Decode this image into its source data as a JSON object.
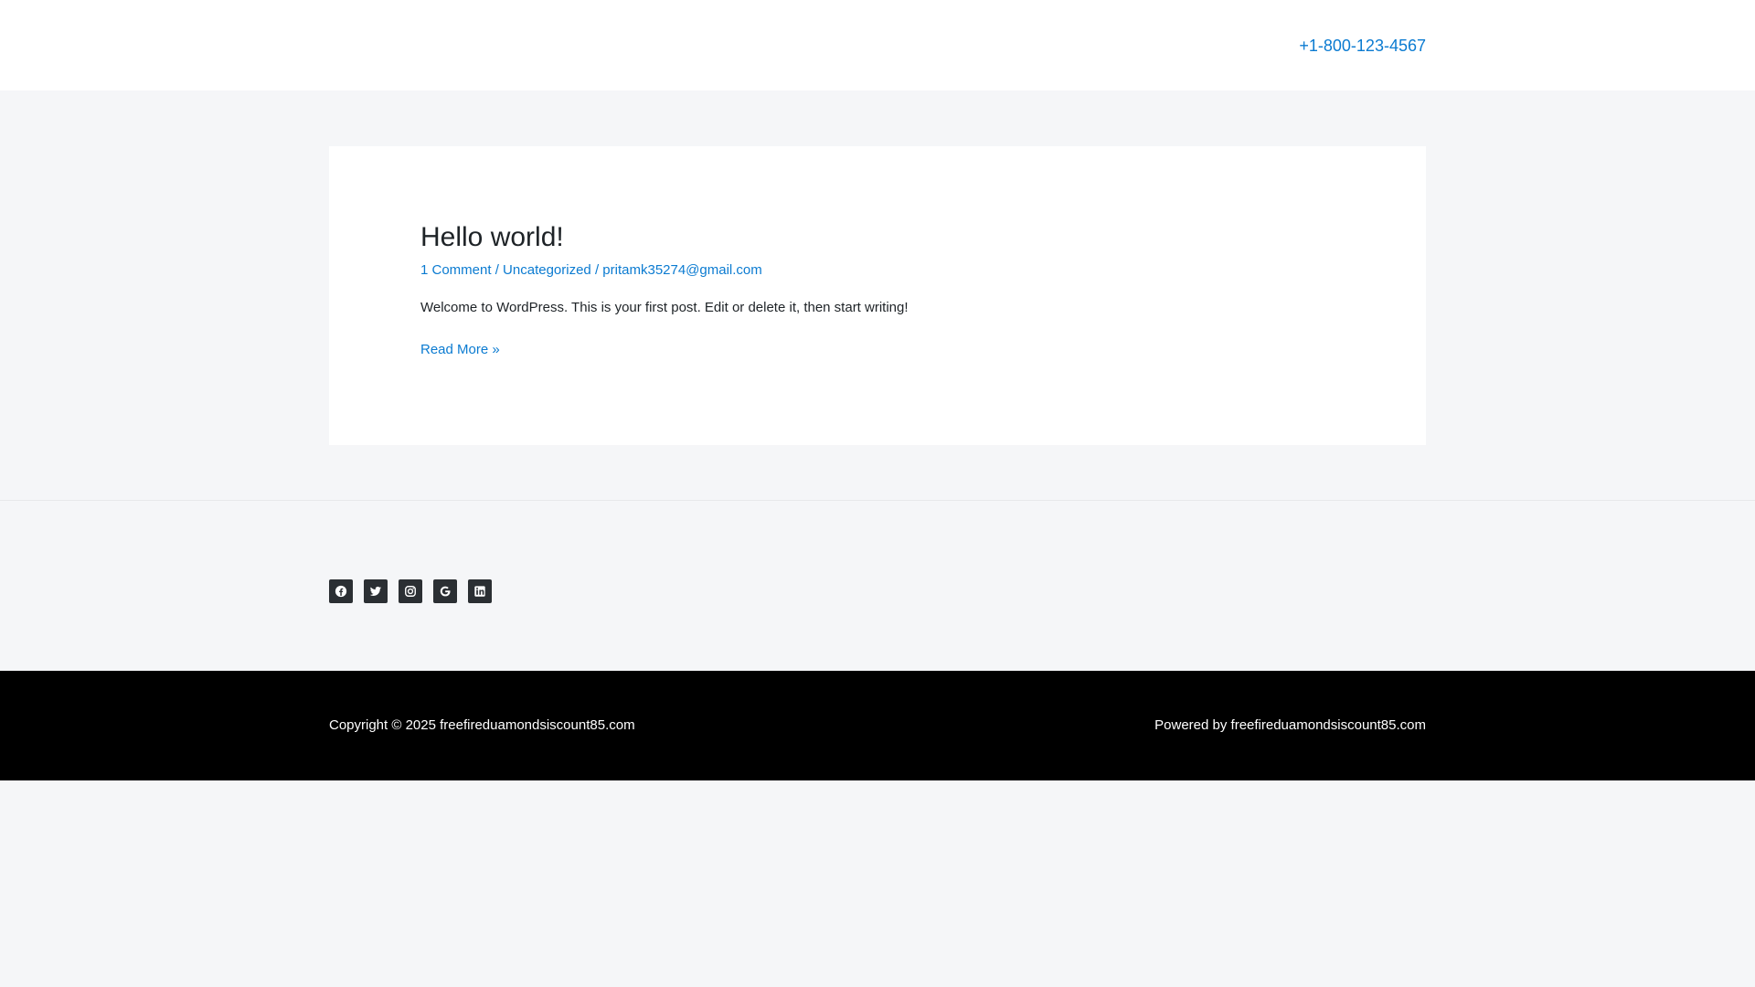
{
  "header": {
    "phone": "+1-800-123-4567"
  },
  "post": {
    "title": "Hello world!",
    "meta": {
      "comments": "1 Comment",
      "separator": " / ",
      "category": "Uncategorized",
      "author": "pritamk35274@gmail.com"
    },
    "excerpt": "Welcome to WordPress. This is your first post. Edit or delete it, then start writing!",
    "read_more": "Read More »"
  },
  "social": {
    "icons": [
      "facebook-icon",
      "twitter-icon",
      "instagram-icon",
      "google-icon",
      "linkedin-icon"
    ]
  },
  "footer": {
    "copyright": "Copyright © 2025 freefireduamondsiscount85.com",
    "powered": "Powered by freefireduamondsiscount85.com"
  },
  "colors": {
    "accent": "#0b7bd1",
    "page_bg": "#f5f6f8",
    "footer_bg": "#000000",
    "social_bg": "#2b2f33"
  }
}
